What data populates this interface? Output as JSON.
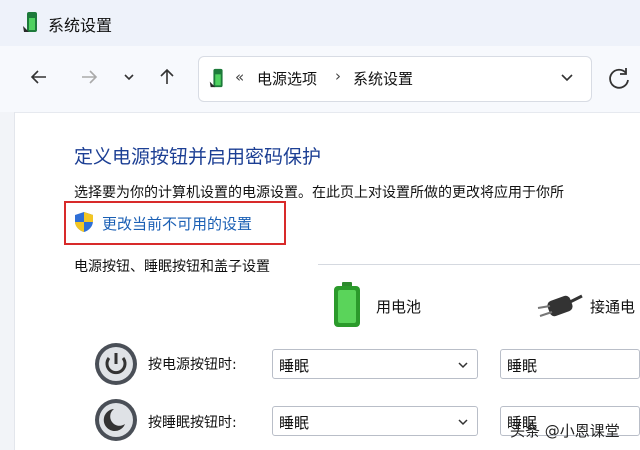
{
  "window": {
    "title": "系统设置"
  },
  "address_bar": {
    "overflow": "«",
    "crumbs": [
      "电源选项",
      "系统设置"
    ]
  },
  "content": {
    "heading": "定义电源按钮并启用密码保护",
    "description": "选择要为你的计算机设置的电源设置。在此页上对设置所做的更改将应用于你所",
    "change_link": "更改当前不可用的设置",
    "group_title": "电源按钮、睡眠按钮和盖子设置",
    "columns": {
      "battery": "用电池",
      "plugged": "接通电"
    },
    "rows": [
      {
        "label": "按电源按钮时:",
        "battery_value": "睡眠",
        "plugged_value": "睡眠"
      },
      {
        "label": "按睡眠按钮时:",
        "battery_value": "睡眠",
        "plugged_value": "睡眠"
      }
    ]
  },
  "watermark": "头条 @小恩课堂",
  "colors": {
    "heading": "#1c3f94",
    "link": "#1a5fb4",
    "highlight_box": "#d82a2a",
    "battery_green": "#3dbb3d"
  }
}
